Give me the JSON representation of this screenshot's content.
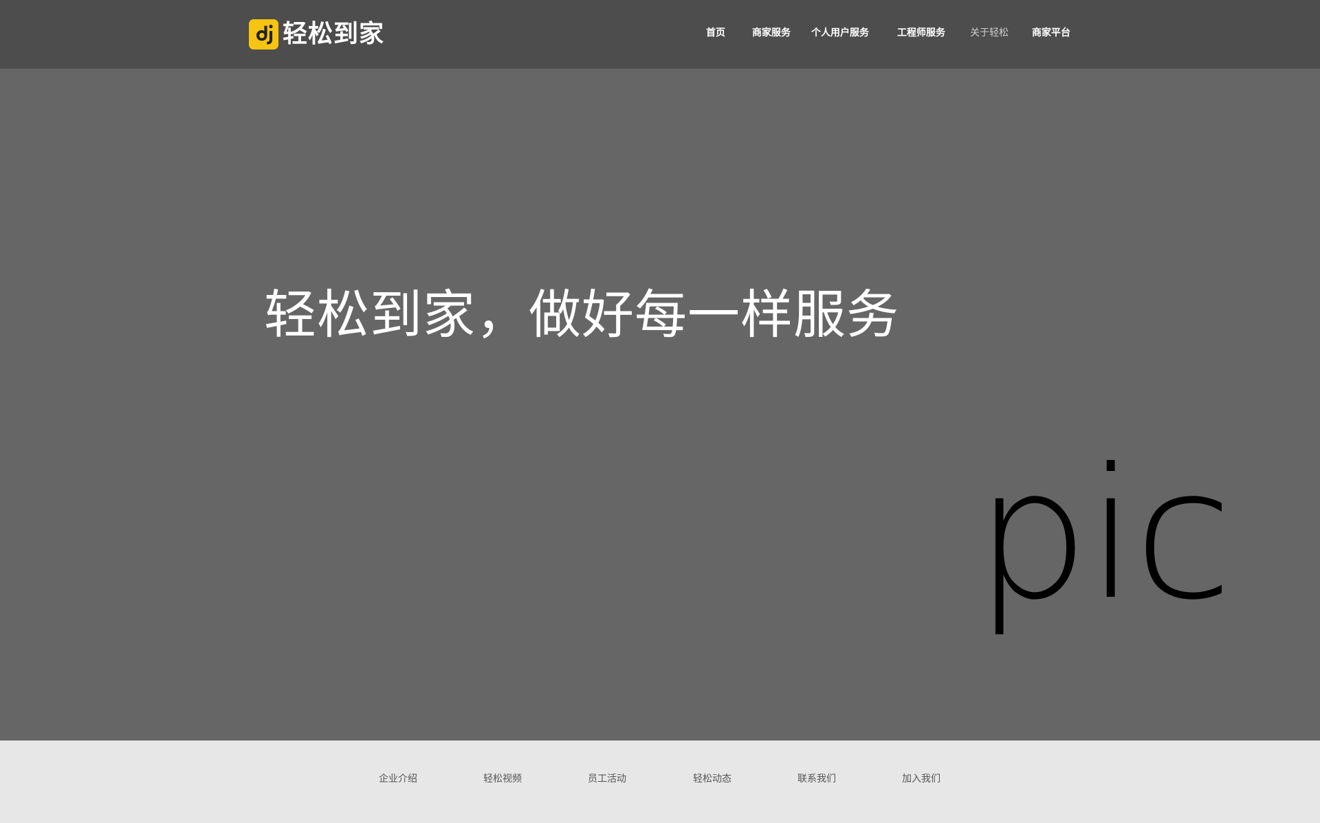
{
  "header": {
    "logo_text": "轻松到家",
    "nav": [
      {
        "label": "首页"
      },
      {
        "label": "商家服务"
      },
      {
        "label": "个人用户服务"
      },
      {
        "label": "工程师服务"
      },
      {
        "label": "关于轻松"
      },
      {
        "label": "商家平台"
      }
    ]
  },
  "hero": {
    "title": "轻松到家，做好每一样服务",
    "placeholder_text": "pic"
  },
  "subnav": {
    "items": [
      {
        "label": "企业介绍"
      },
      {
        "label": "轻松视频"
      },
      {
        "label": "员工活动"
      },
      {
        "label": "轻松动态"
      },
      {
        "label": "联系我们"
      },
      {
        "label": "加入我们"
      }
    ]
  },
  "colors": {
    "header_bg": "#4d4d4d",
    "hero_bg": "#666666",
    "subnav_bg": "#e7e7e7",
    "logo_accent": "#f7c411"
  }
}
